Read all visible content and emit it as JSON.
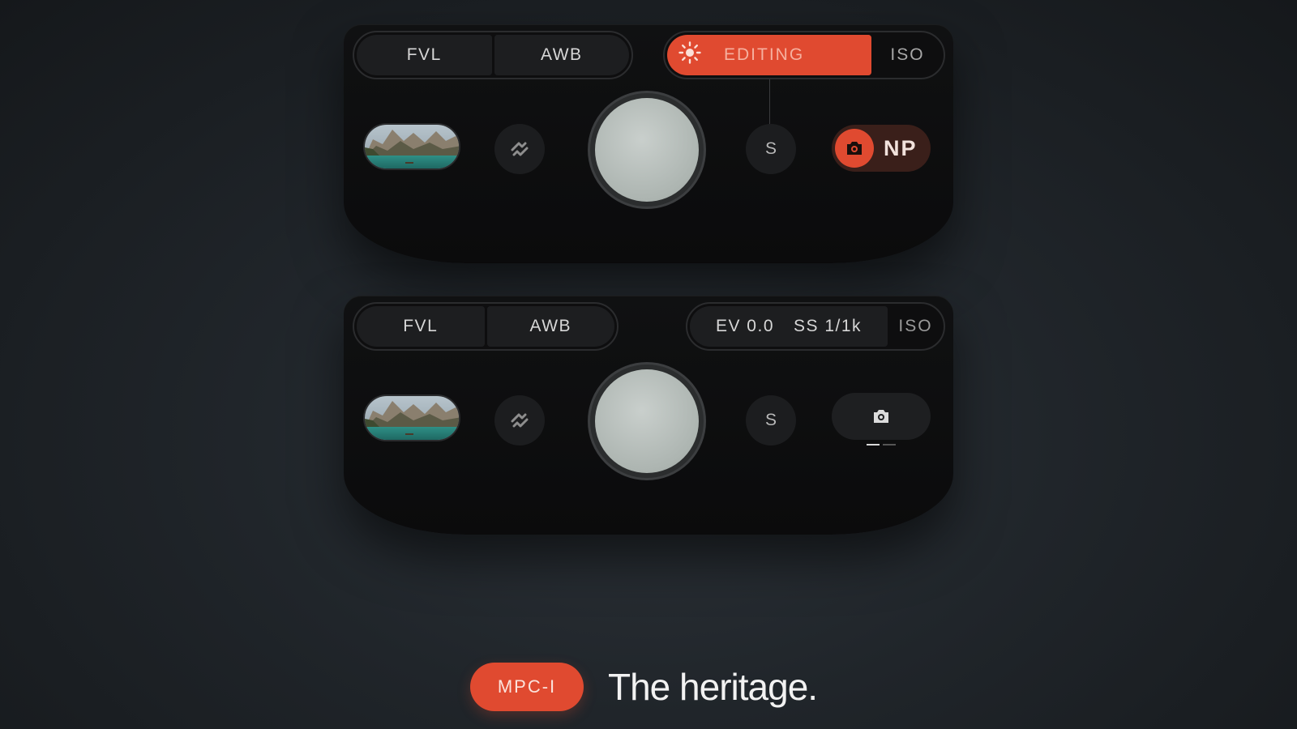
{
  "top_panel": {
    "mode_left": "FVL",
    "mode_right": "AWB",
    "editing_label": "EDITING",
    "iso_label": "ISO",
    "s_label": "S",
    "np_label": "NP"
  },
  "bottom_panel": {
    "mode_left": "FVL",
    "mode_right": "AWB",
    "ev_label": "EV 0.0",
    "ss_label": "SS 1/1k",
    "iso_label": "ISO",
    "s_label": "S"
  },
  "footer": {
    "badge": "MPC-I",
    "headline": "The heritage."
  },
  "colors": {
    "accent": "#e04a30",
    "panel": "#0e0e0f",
    "background": "#22272c"
  },
  "icons": [
    "sun-icon",
    "swap-icon",
    "camera-icon",
    "landscape-thumbnail"
  ]
}
